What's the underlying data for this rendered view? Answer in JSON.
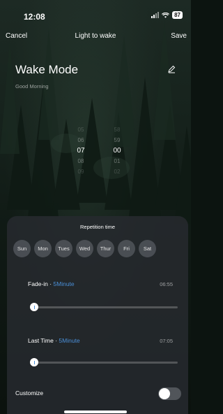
{
  "status_bar": {
    "time": "12:08",
    "battery": "87"
  },
  "nav": {
    "cancel": "Cancel",
    "title": "Light to wake",
    "save": "Save"
  },
  "mode": {
    "title": "Wake Mode",
    "subtitle": "Good Morning",
    "edit_icon": "pencil-icon"
  },
  "time_picker": {
    "hours": [
      "05",
      "06",
      "07",
      "08",
      "09"
    ],
    "minutes": [
      "58",
      "59",
      "00",
      "01",
      "02"
    ],
    "selected_hour": "07",
    "selected_minute": "00"
  },
  "repetition": {
    "title": "Repetition time",
    "days": [
      "Sun",
      "Mon",
      "Tues",
      "Wed",
      "Thur",
      "Fri",
      "Sat"
    ]
  },
  "fade_in": {
    "label": "Fade-in",
    "separator": " · ",
    "duration": "5Minute",
    "time": "06:55",
    "progress": 0.0
  },
  "last_time": {
    "label": "Last Time",
    "separator": " · ",
    "duration": "5Minute",
    "time": "07:05",
    "progress": 0.0
  },
  "customize": {
    "label": "Customize",
    "enabled": false
  },
  "colors": {
    "accent": "#4a8fd8",
    "panel": "#262a2e"
  }
}
